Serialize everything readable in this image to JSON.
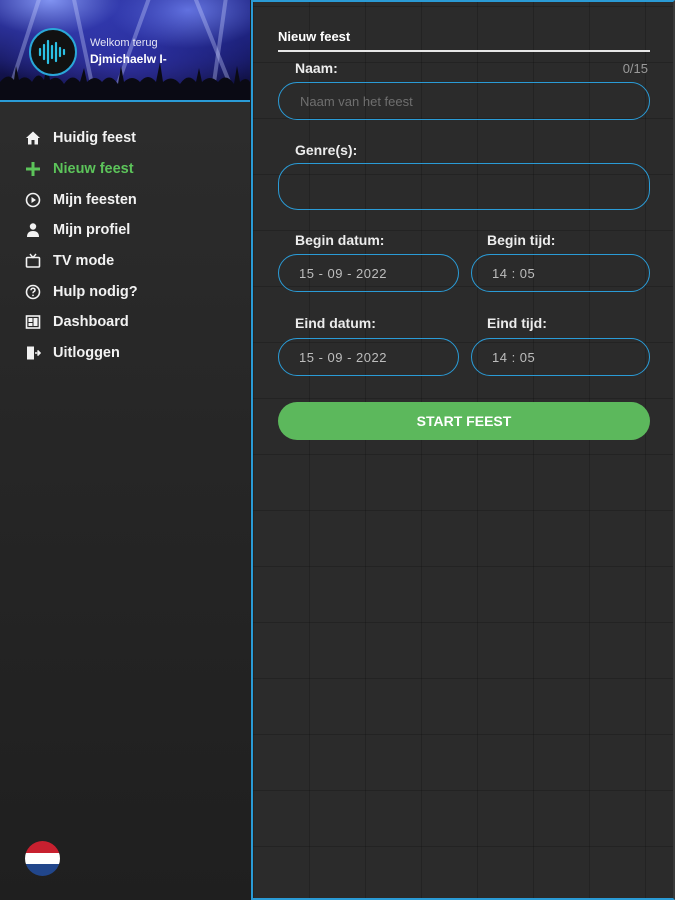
{
  "sidebar": {
    "welcome": "Welkom terug",
    "username": "Djmichaelw I-",
    "items": [
      {
        "label": "Huidig feest",
        "icon": "home-icon"
      },
      {
        "label": "Nieuw feest",
        "icon": "plus-icon",
        "active": true
      },
      {
        "label": "Mijn feesten",
        "icon": "play-circle-icon"
      },
      {
        "label": "Mijn profiel",
        "icon": "user-icon"
      },
      {
        "label": "TV mode",
        "icon": "tv-icon"
      },
      {
        "label": "Hulp nodig?",
        "icon": "help-circle-icon"
      },
      {
        "label": "Dashboard",
        "icon": "dashboard-icon"
      },
      {
        "label": "Uitloggen",
        "icon": "logout-icon"
      }
    ],
    "language_flag": "netherlands-flag-icon"
  },
  "form": {
    "title": "Nieuw feest",
    "name_label": "Naam:",
    "name_counter": "0/15",
    "name_placeholder": "Naam van het feest",
    "genre_label": "Genre(s):",
    "begin_date_label": "Begin datum:",
    "begin_date_value": "15 - 09 - 2022",
    "begin_time_label": "Begin tijd:",
    "begin_time_value": "14 : 05",
    "end_date_label": "Eind datum:",
    "end_date_value": "15 - 09 - 2022",
    "end_time_label": "Eind tijd:",
    "end_time_value": "14 : 05",
    "submit_label": "START FEEST"
  },
  "colors": {
    "accent_blue": "#2a9bd6",
    "active_green": "#5cc45a",
    "button_green": "#5cb85c",
    "background": "#2b2b2b"
  }
}
